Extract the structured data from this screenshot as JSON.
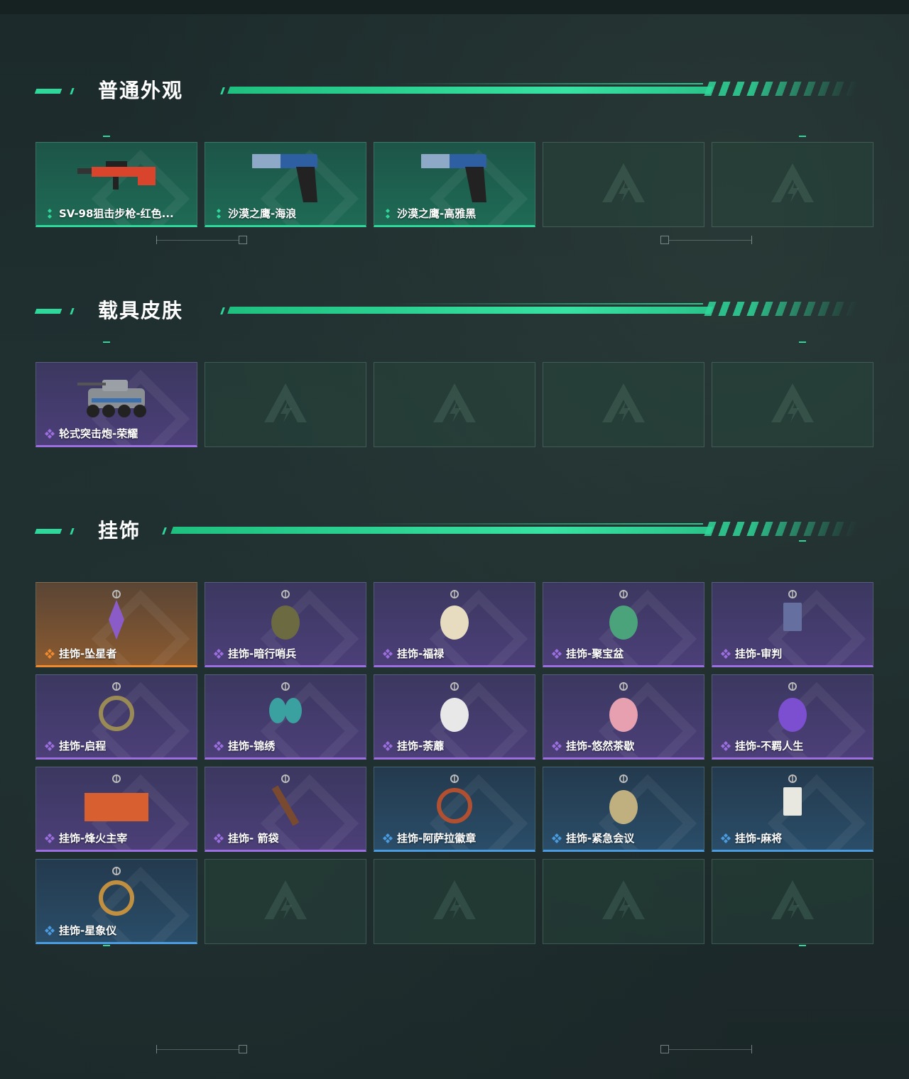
{
  "sections": [
    {
      "title": "普通外观",
      "cards": [
        {
          "label": "SV-98狙击步枪-红色...",
          "tier": "green",
          "icon": "sniper-rifle-icon"
        },
        {
          "label": "沙漠之鹰-海浪",
          "tier": "green",
          "icon": "pistol-icon"
        },
        {
          "label": "沙漠之鹰-高雅黑",
          "tier": "green",
          "icon": "pistol-icon"
        },
        {
          "label": "",
          "tier": "empty",
          "icon": "placeholder-logo-icon"
        },
        {
          "label": "",
          "tier": "empty",
          "icon": "placeholder-logo-icon"
        }
      ]
    },
    {
      "title": "载具皮肤",
      "cards": [
        {
          "label": "轮式突击炮-荣耀",
          "tier": "purple",
          "icon": "armored-vehicle-icon"
        },
        {
          "label": "",
          "tier": "empty",
          "icon": "placeholder-logo-icon"
        },
        {
          "label": "",
          "tier": "empty",
          "icon": "placeholder-logo-icon"
        },
        {
          "label": "",
          "tier": "empty",
          "icon": "placeholder-logo-icon"
        },
        {
          "label": "",
          "tier": "empty",
          "icon": "placeholder-logo-icon"
        }
      ]
    },
    {
      "title": "挂饰",
      "cards": [
        {
          "label": "挂饰-坠星者",
          "tier": "orange",
          "icon": "crystal-charm-icon"
        },
        {
          "label": "挂饰-暗行哨兵",
          "tier": "purple",
          "icon": "soldier-charm-icon"
        },
        {
          "label": "挂饰-福禄",
          "tier": "purple",
          "icon": "gourd-charm-icon"
        },
        {
          "label": "挂饰-聚宝盆",
          "tier": "purple",
          "icon": "treasure-bowl-charm-icon"
        },
        {
          "label": "挂饰-审判",
          "tier": "purple",
          "icon": "card-charm-icon"
        },
        {
          "label": "挂饰-启程",
          "tier": "purple",
          "icon": "medallion-charm-icon"
        },
        {
          "label": "挂饰-锦绣",
          "tier": "purple",
          "icon": "butterfly-charm-icon"
        },
        {
          "label": "挂饰-荼蘼",
          "tier": "purple",
          "icon": "doll-charm-icon"
        },
        {
          "label": "挂饰-悠然茶歇",
          "tier": "purple",
          "icon": "cupcake-charm-icon"
        },
        {
          "label": "挂饰-不羁人生",
          "tier": "purple",
          "icon": "sneaker-charm-icon"
        },
        {
          "label": "挂饰-烽火主宰",
          "tier": "purple",
          "icon": "graffiti-container-charm-icon"
        },
        {
          "label": "挂饰- 箭袋",
          "tier": "purple",
          "icon": "quiver-charm-icon"
        },
        {
          "label": "挂饰-阿萨拉徽章",
          "tier": "blue",
          "icon": "badge-charm-icon"
        },
        {
          "label": "挂饰-紧急会议",
          "tier": "blue",
          "icon": "robot-charm-icon"
        },
        {
          "label": "挂饰-麻将",
          "tier": "blue",
          "icon": "mahjong-charm-icon"
        },
        {
          "label": "挂饰-星象仪",
          "tier": "blue",
          "icon": "orrery-charm-icon"
        },
        {
          "label": "",
          "tier": "empty",
          "icon": "placeholder-logo-icon"
        },
        {
          "label": "",
          "tier": "empty",
          "icon": "placeholder-logo-icon"
        },
        {
          "label": "",
          "tier": "empty",
          "icon": "placeholder-logo-icon"
        },
        {
          "label": "",
          "tier": "empty",
          "icon": "placeholder-logo-icon"
        }
      ]
    }
  ],
  "colors": {
    "accent": "#2fd79a",
    "tier_green": "#2fd79a",
    "tier_purple": "#9b6fe0",
    "tier_orange": "#ef8a2e",
    "tier_blue": "#4a9be0"
  }
}
